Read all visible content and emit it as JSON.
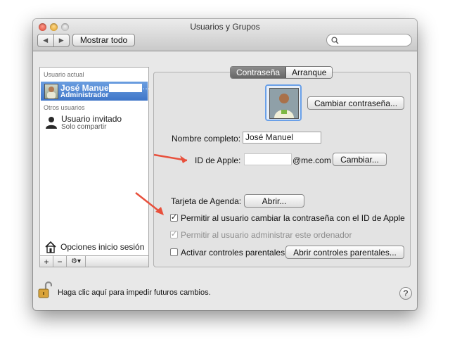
{
  "window": {
    "title": "Usuarios y Grupos"
  },
  "toolbar": {
    "back_icon": "chevron-left-icon",
    "forward_icon": "chevron-right-icon",
    "show_all_label": "Mostrar todo",
    "search_placeholder": ""
  },
  "sidebar": {
    "current_user_heading": "Usuario actual",
    "current_user": {
      "name": "José Manuel",
      "redacted_suffix": "…",
      "role": "Administrador"
    },
    "other_users_heading": "Otros usuarios",
    "guest_user": {
      "name": "Usuario invitado",
      "role": "Solo compartir"
    },
    "login_options_label": "Opciones inicio sesión",
    "add_label": "+",
    "remove_label": "−",
    "gear_label": "⚙▾"
  },
  "tabs": [
    {
      "label": "Contraseña",
      "selected": true
    },
    {
      "label": "Arranque",
      "selected": false
    }
  ],
  "form": {
    "change_password_label": "Cambiar contraseña...",
    "full_name_label": "Nombre completo:",
    "full_name_value": "José Manuel",
    "apple_id_label": "ID de Apple:",
    "apple_id_value": "",
    "apple_id_domain": "@me.com",
    "change_apple_id_label": "Cambiar...",
    "address_card_label": "Tarjeta de Agenda:",
    "open_label": "Abrir...",
    "allow_reset_label": "Permitir al usuario cambiar la contraseña con el ID de Apple",
    "allow_reset_checked": true,
    "allow_admin_label": "Permitir al usuario administrar este ordenador",
    "allow_admin_checked": true,
    "allow_admin_enabled": false,
    "parental_label": "Activar controles parentales",
    "parental_checked": false,
    "open_parental_label": "Abrir controles parentales..."
  },
  "footer": {
    "lock_text": "Haga clic aquí para impedir futuros cambios.",
    "help_label": "?"
  },
  "colors": {
    "selection": "#3f76c8",
    "annotation_arrow": "#e8503c",
    "focus_ring": "#6aa0e8"
  }
}
